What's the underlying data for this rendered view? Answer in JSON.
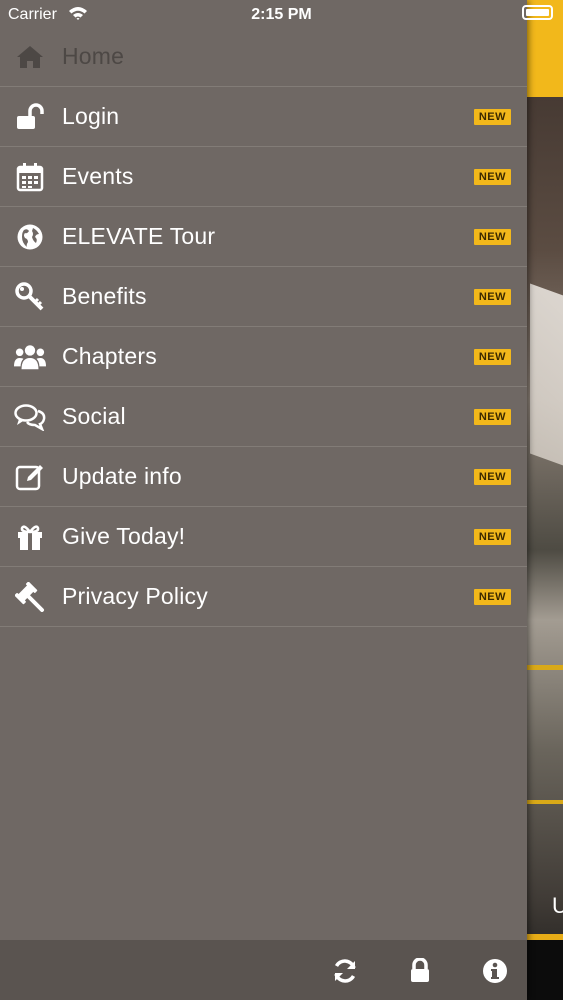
{
  "status_bar": {
    "carrier": "Carrier",
    "time": "2:15 PM"
  },
  "menu": {
    "items": [
      {
        "label": "Home",
        "icon": "home-icon",
        "badge": "",
        "active": true
      },
      {
        "label": "Login",
        "icon": "unlock-icon",
        "badge": "NEW"
      },
      {
        "label": "Events",
        "icon": "calendar-icon",
        "badge": "NEW"
      },
      {
        "label": "ELEVATE Tour",
        "icon": "globe-icon",
        "badge": "NEW"
      },
      {
        "label": "Benefits",
        "icon": "key-icon",
        "badge": "NEW"
      },
      {
        "label": "Chapters",
        "icon": "users-icon",
        "badge": "NEW"
      },
      {
        "label": "Social",
        "icon": "comments-icon",
        "badge": "NEW"
      },
      {
        "label": "Update info",
        "icon": "edit-icon",
        "badge": "NEW"
      },
      {
        "label": "Give Today!",
        "icon": "gift-icon",
        "badge": "NEW"
      },
      {
        "label": "Privacy Policy",
        "icon": "gavel-icon",
        "badge": "NEW"
      }
    ]
  },
  "toolbar": {
    "refresh_icon": "refresh-icon",
    "lock_icon": "lock-icon",
    "info_icon": "info-icon"
  },
  "colors": {
    "drawer_bg": "#6f6864",
    "badge_bg": "#f2b81b",
    "toolbar_bg": "#5a5450",
    "accent_yellow": "#f2b81b"
  },
  "background_app": {
    "partial_text": "U"
  }
}
